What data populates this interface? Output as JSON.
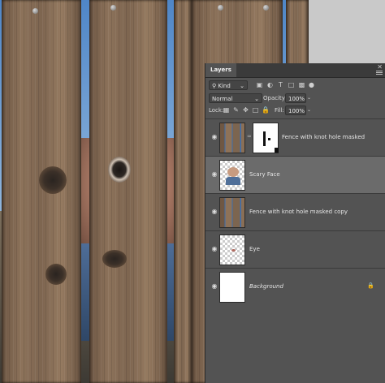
{
  "panel": {
    "title": "Layers",
    "close_glyph": "✕",
    "filter": {
      "kind_label": "Kind",
      "kind_icon": "search-icon"
    },
    "filter_icons": [
      "image-filter-icon",
      "adjustment-filter-icon",
      "type-filter-icon",
      "shape-filter-icon",
      "smart-object-filter-icon",
      "filter-toggle-dot-icon"
    ],
    "blend_mode": "Normal",
    "opacity_label": "Opacity:",
    "opacity_value": "100%",
    "lock_label": "Lock:",
    "lock_icons": [
      "lock-transparent-pixels-icon",
      "lock-image-pixels-icon",
      "lock-position-icon",
      "lock-artboard-icon",
      "lock-all-icon"
    ],
    "fill_label": "Fill:",
    "fill_value": "100%"
  },
  "layers": [
    {
      "name": "Fence with knot hole masked",
      "thumb": "fence",
      "has_mask": true,
      "selected": false,
      "italic": false,
      "locked": false
    },
    {
      "name": "Scary Face",
      "thumb": "face",
      "has_mask": false,
      "selected": true,
      "italic": false,
      "locked": false
    },
    {
      "name": "Fence with knot hole masked copy",
      "thumb": "fence",
      "has_mask": false,
      "selected": false,
      "italic": false,
      "locked": false
    },
    {
      "name": "Eye",
      "thumb": "eye",
      "has_mask": false,
      "selected": false,
      "italic": false,
      "locked": false
    },
    {
      "name": "Background",
      "thumb": "white",
      "has_mask": false,
      "selected": false,
      "italic": true,
      "locked": true
    }
  ],
  "colors": {
    "panel_bg": "#535353",
    "selected_row": "#6b6b6b",
    "tab_bar": "#3b3b3b"
  }
}
